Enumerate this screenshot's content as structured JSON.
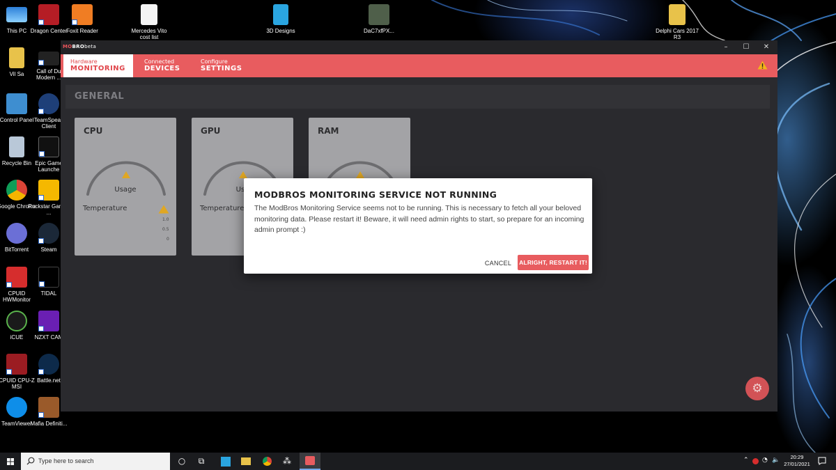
{
  "desktop": {
    "icons": [
      {
        "label": "This PC"
      },
      {
        "label": "Dragon Center"
      },
      {
        "label": "Foxit Reader"
      },
      {
        "label": "Mercedes Vito cost list"
      },
      {
        "label": "3D Designs"
      },
      {
        "label": "DaC7xfPX..."
      },
      {
        "label": "Delphi Cars 2017 R3"
      },
      {
        "label": "Vil Sa"
      },
      {
        "label": "Call of Du Modern ..."
      },
      {
        "label": "Control Panel"
      },
      {
        "label": "TeamSpeak Client"
      },
      {
        "label": "Recycle Bin"
      },
      {
        "label": "Epic Game Launche"
      },
      {
        "label": "Google Chrome"
      },
      {
        "label": "Rockstar Games ..."
      },
      {
        "label": "BitTorrent"
      },
      {
        "label": "Steam"
      },
      {
        "label": "CPUID HWMonitor"
      },
      {
        "label": "TIDAL"
      },
      {
        "label": "iCUE"
      },
      {
        "label": "NZXT CAM"
      },
      {
        "label": "CPUID CPU-Z MSI"
      },
      {
        "label": "Battle.net"
      },
      {
        "label": "TeamViewer"
      },
      {
        "label": "Mafia Definiti..."
      }
    ]
  },
  "app": {
    "logo_prefix": "MO",
    "logo_main": "BRO",
    "logo_suffix": "beta",
    "window_controls": {
      "minimize": "–",
      "maximize": "☐",
      "close": "✕"
    },
    "tabs": [
      {
        "small": "Hardware",
        "big": "MONITORING",
        "active": true
      },
      {
        "small": "Connected",
        "big": "DEVICES",
        "active": false
      },
      {
        "small": "Configure",
        "big": "SETTINGS",
        "active": false
      }
    ],
    "section_title": "GENERAL",
    "cards": [
      {
        "title": "CPU",
        "gauge_label": "Usage",
        "temp_label": "Temperature",
        "ticks": [
          "1.0",
          "0.5",
          "0"
        ]
      },
      {
        "title": "GPU",
        "gauge_label": "Usa",
        "temp_label": "Temperature"
      },
      {
        "title": "RAM"
      }
    ],
    "gear_icon": "gear-icon",
    "accent": "#e85c5f"
  },
  "dialog": {
    "title": "MODBROS MONITORING SERVICE NOT RUNNING",
    "body": "The ModBros Monitoring Service seems not to be running. This is necessary to fetch all your beloved monitoring data. Please restart it! Beware, it will need admin rights to start, so prepare for an incoming admin prompt :)",
    "cancel_label": "CANCEL",
    "confirm_label": "ALRIGHT, RESTART IT!"
  },
  "taskbar": {
    "search_placeholder": "Type here to search",
    "time": "20:29",
    "date": "27/01/2021"
  }
}
